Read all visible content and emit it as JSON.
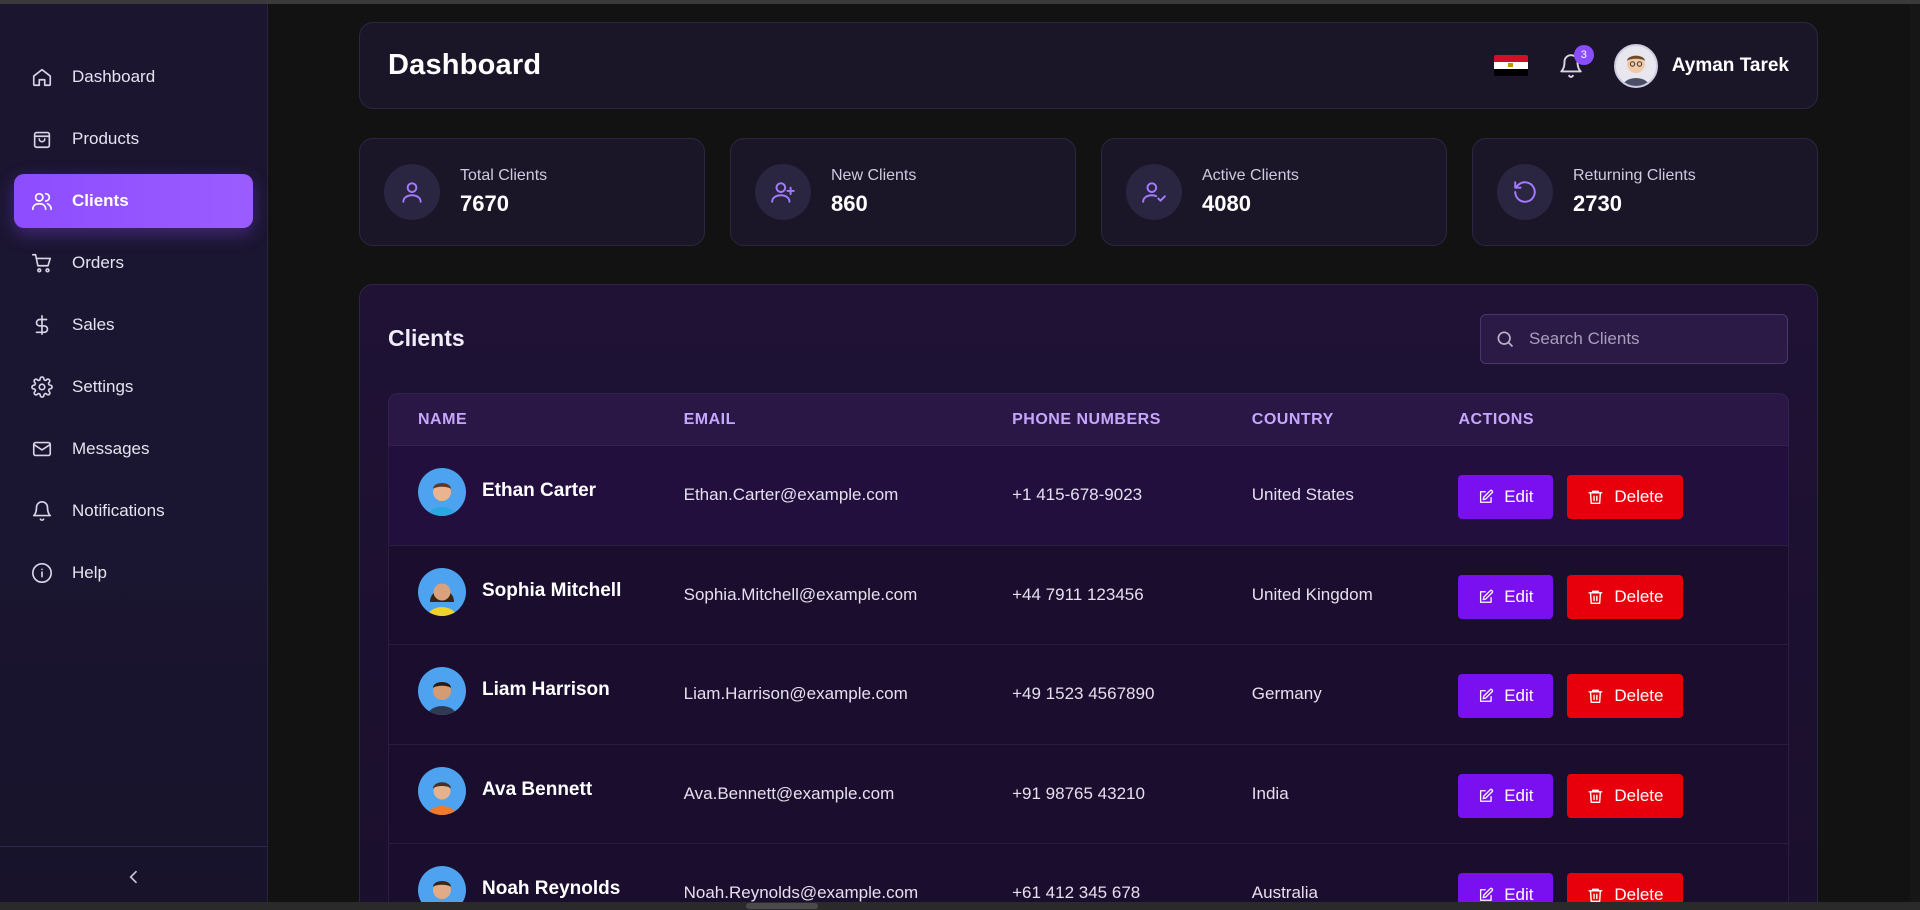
{
  "sidebar": {
    "items": [
      {
        "label": "Dashboard",
        "icon": "home-icon"
      },
      {
        "label": "Products",
        "icon": "shopping-bag-icon"
      },
      {
        "label": "Clients",
        "icon": "users-icon",
        "active": true
      },
      {
        "label": "Orders",
        "icon": "shopping-cart-icon"
      },
      {
        "label": "Sales",
        "icon": "dollar-icon"
      },
      {
        "label": "Settings",
        "icon": "gear-icon"
      },
      {
        "label": "Messages",
        "icon": "mail-icon"
      },
      {
        "label": "Notifications",
        "icon": "bell-icon"
      },
      {
        "label": "Help",
        "icon": "info-icon"
      }
    ],
    "collapse_icon": "chevron-left-icon"
  },
  "header": {
    "title": "Dashboard",
    "notification_count": "3",
    "user_name": "Ayman Tarek"
  },
  "stats": [
    {
      "label": "Total Clients",
      "value": "7670",
      "icon": "user-icon"
    },
    {
      "label": "New Clients",
      "value": "860",
      "icon": "user-plus-icon"
    },
    {
      "label": "Active Clients",
      "value": "4080",
      "icon": "user-check-icon"
    },
    {
      "label": "Returning Clients",
      "value": "2730",
      "icon": "refresh-icon"
    }
  ],
  "clients": {
    "title": "Clients",
    "search_placeholder": "Search Clients",
    "columns": [
      "NAME",
      "EMAIL",
      "PHONE NUMBERS",
      "COUNTRY",
      "ACTIONS"
    ],
    "edit_label": "Edit",
    "delete_label": "Delete",
    "rows": [
      {
        "name": "Ethan Carter",
        "email": "Ethan.Carter@example.com",
        "phone": "+1 415-678-9023",
        "country": "United States"
      },
      {
        "name": "Sophia Mitchell",
        "email": "Sophia.Mitchell@example.com",
        "phone": "+44 7911 123456",
        "country": "United Kingdom"
      },
      {
        "name": "Liam Harrison",
        "email": "Liam.Harrison@example.com",
        "phone": "+49 1523 4567890",
        "country": "Germany"
      },
      {
        "name": "Ava Bennett",
        "email": "Ava.Bennett@example.com",
        "phone": "+91 98765 43210",
        "country": "India"
      },
      {
        "name": "Noah Reynolds",
        "email": "Noah.Reynolds@example.com",
        "phone": "+61 412 345 678",
        "country": "Australia"
      }
    ]
  },
  "colors": {
    "accent": "#9b5cff",
    "edit": "#7a0ff0",
    "delete": "#e7000b",
    "header_text": "#c7a6ff"
  }
}
